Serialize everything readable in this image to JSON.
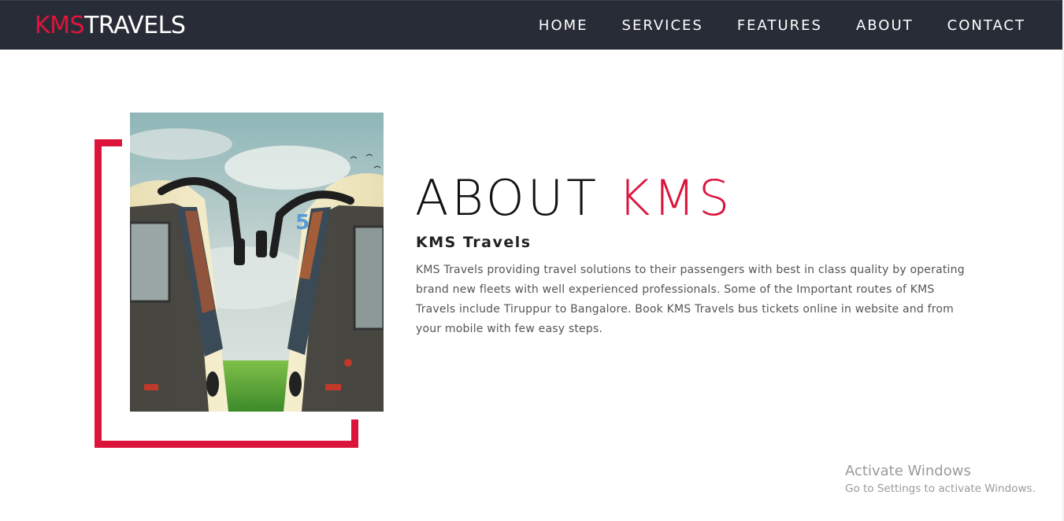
{
  "header": {
    "brand": {
      "accent": "KMS",
      "rest": "TRAVELS"
    },
    "nav": [
      "HOME",
      "SERVICES",
      "FEATURES",
      "ABOUT",
      "CONTACT"
    ]
  },
  "about": {
    "title_main": "ABOUT",
    "title_accent": "KMS",
    "subtitle": "KMS Travels",
    "paragraph": "KMS Travels providing travel solutions to their passengers with best in class quality by operating brand new fleets with well experienced professionals. Some of the Important routes of KMS Travels include Tiruppur to Bangalore. Book KMS Travels bus tickets online in website and from your mobile with few easy steps.",
    "image_alt": "two-buses-facing-image"
  },
  "watermark": {
    "line1": "Activate Windows",
    "line2": "Go to Settings to activate Windows."
  },
  "colors": {
    "accent": "#dc143c",
    "navbar_bg": "#282c37",
    "text_dark": "#111111",
    "text_body": "#555555"
  }
}
